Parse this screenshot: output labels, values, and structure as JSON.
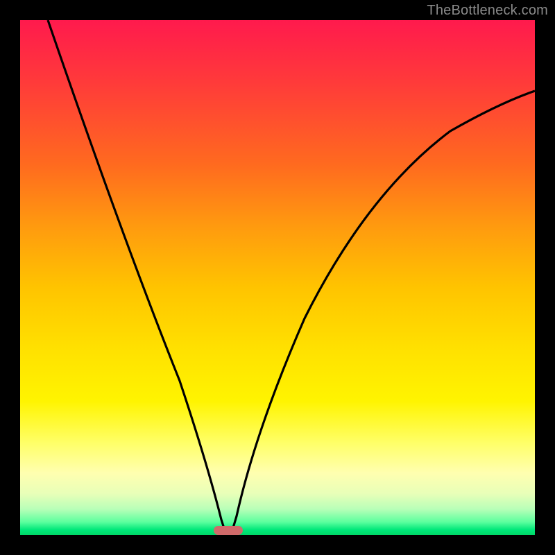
{
  "watermark": "TheBottleneck.com",
  "colors": {
    "frame": "#000000",
    "curve": "#000000",
    "marker": "#d06a6a",
    "gradient_stops": [
      "#ff1a4d",
      "#ff6a1f",
      "#ffc400",
      "#ffff66",
      "#5cff9e",
      "#00d868"
    ]
  },
  "chart_data": {
    "type": "line",
    "title": "",
    "xlabel": "",
    "ylabel": "",
    "x": [
      0.0,
      0.05,
      0.1,
      0.15,
      0.2,
      0.25,
      0.3,
      0.36,
      0.39,
      0.4,
      0.41,
      0.44,
      0.5,
      0.55,
      0.6,
      0.65,
      0.7,
      0.75,
      0.8,
      0.85,
      0.9,
      0.95,
      1.0
    ],
    "series": [
      {
        "name": "left-branch",
        "x": [
          0.0,
          0.05,
          0.1,
          0.15,
          0.2,
          0.25,
          0.3,
          0.34,
          0.37,
          0.39,
          0.4
        ],
        "y": [
          1.0,
          0.88,
          0.76,
          0.63,
          0.5,
          0.37,
          0.24,
          0.14,
          0.06,
          0.01,
          0.0
        ]
      },
      {
        "name": "right-branch",
        "x": [
          0.4,
          0.41,
          0.44,
          0.48,
          0.52,
          0.56,
          0.6,
          0.65,
          0.7,
          0.75,
          0.8,
          0.85,
          0.9,
          0.95,
          1.0
        ],
        "y": [
          0.0,
          0.02,
          0.11,
          0.22,
          0.32,
          0.41,
          0.49,
          0.57,
          0.64,
          0.7,
          0.75,
          0.79,
          0.82,
          0.84,
          0.86
        ]
      }
    ],
    "marker": {
      "x": 0.4,
      "y": 0.0,
      "width_frac": 0.055,
      "height_frac": 0.018
    },
    "xlim": [
      0,
      1
    ],
    "ylim": [
      0,
      1
    ],
    "notes": "x and y are normalized to the plot area (0 = bottom/left, 1 = top/right). No axis ticks or labels visible."
  }
}
